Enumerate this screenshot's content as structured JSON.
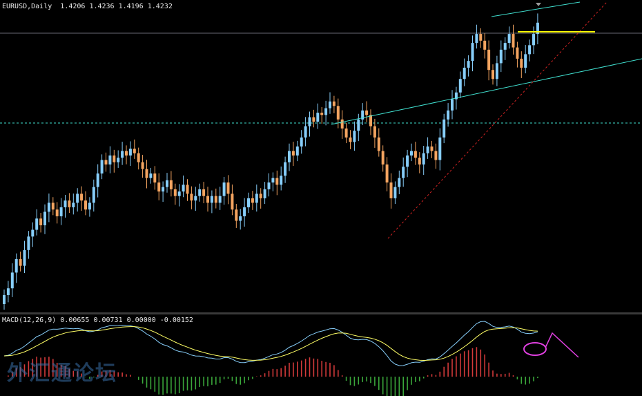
{
  "chart": {
    "symbol_label": "EURUSD,Daily",
    "ohlc_label": "1.4206 1.4236 1.4196 1.4232",
    "macd_label": "MACD(12,26,9) 0.00655 0.00731 0.00000 -0.00152",
    "watermark": "外汇通论坛"
  },
  "colors": {
    "background": "#000000",
    "bull": "#87CEFA",
    "bear": "#F4A460",
    "trendline": "#40E0D0",
    "dashed_level": "#40E0D0",
    "yellow_level": "#FFFF00",
    "red_trend": "#CC2222",
    "macd_main": "#87CEFA",
    "macd_signal": "#FFFF66",
    "hist_pos": "#D33A3A",
    "hist_neg": "#3AA63A",
    "annotation": "#E040E0"
  },
  "chart_data": {
    "type": "candlestick",
    "title": "EURUSD,Daily",
    "last_ohlc": {
      "open": 1.4206,
      "high": 1.4236,
      "low": 1.4196,
      "close": 1.4232
    },
    "closes": [
      1.302,
      1.305,
      1.312,
      1.318,
      1.315,
      1.322,
      1.328,
      1.331,
      1.336,
      1.333,
      1.339,
      1.343,
      1.34,
      1.337,
      1.341,
      1.344,
      1.341,
      1.343,
      1.347,
      1.344,
      1.34,
      1.343,
      1.35,
      1.356,
      1.362,
      1.36,
      1.364,
      1.361,
      1.363,
      1.366,
      1.364,
      1.367,
      1.365,
      1.361,
      1.358,
      1.354,
      1.356,
      1.352,
      1.348,
      1.35,
      1.353,
      1.349,
      1.346,
      1.348,
      1.351,
      1.347,
      1.344,
      1.346,
      1.349,
      1.346,
      1.343,
      1.346,
      1.343,
      1.346,
      1.352,
      1.347,
      1.34,
      1.335,
      1.337,
      1.341,
      1.345,
      1.343,
      1.347,
      1.345,
      1.349,
      1.352,
      1.354,
      1.351,
      1.355,
      1.361,
      1.366,
      1.364,
      1.368,
      1.372,
      1.377,
      1.381,
      1.379,
      1.383,
      1.382,
      1.385,
      1.388,
      1.386,
      1.38,
      1.376,
      1.372,
      1.37,
      1.375,
      1.38,
      1.384,
      1.382,
      1.377,
      1.372,
      1.366,
      1.36,
      1.352,
      1.345,
      1.35,
      1.354,
      1.359,
      1.364,
      1.366,
      1.363,
      1.36,
      1.365,
      1.368,
      1.366,
      1.362,
      1.372,
      1.38,
      1.384,
      1.389,
      1.392,
      1.398,
      1.403,
      1.406,
      1.414,
      1.418,
      1.415,
      1.411,
      1.402,
      1.398,
      1.405,
      1.411,
      1.414,
      1.418,
      1.412,
      1.407,
      1.403,
      1.409,
      1.413,
      1.418,
      1.423
    ],
    "macd": {
      "fast": 12,
      "slow": 26,
      "signal": 9,
      "main": 0.00655,
      "signal_value": 0.00731,
      "osma": -0.00152
    }
  }
}
